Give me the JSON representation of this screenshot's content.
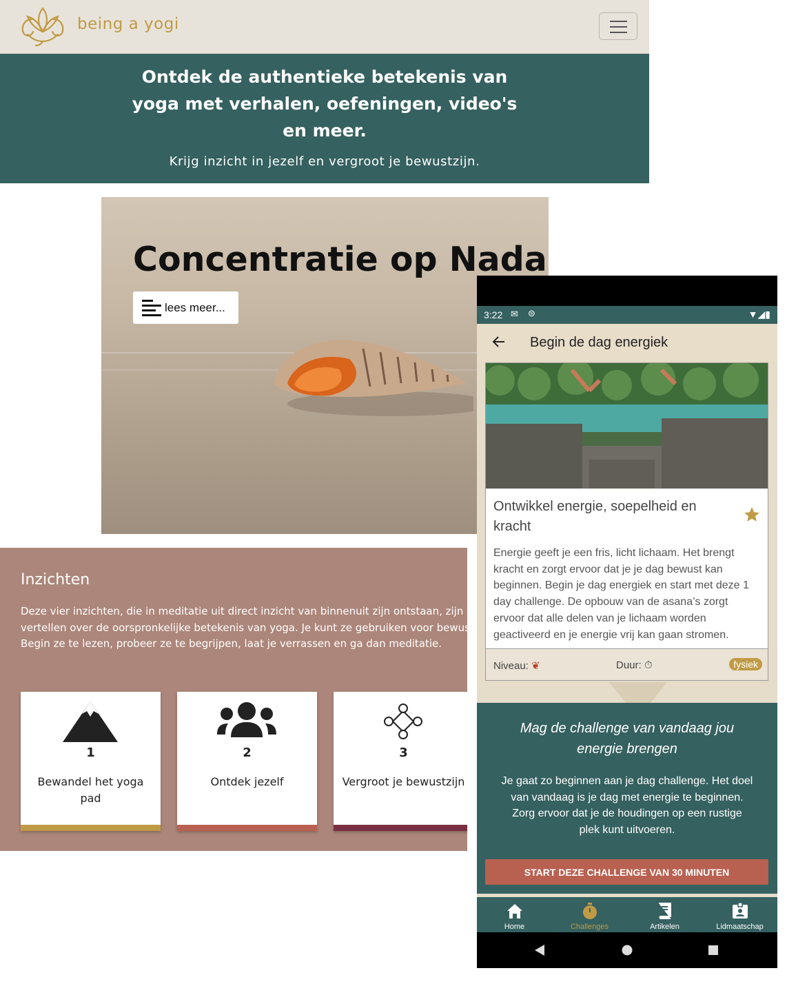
{
  "site": {
    "logo_text": "being a yogi",
    "hero_title": "Ontdek de authentieke betekenis van yoga met verhalen, oefeningen, video's en meer.",
    "hero_subtitle": "Krijg inzicht in jezelf en vergroot je bewustzijn.",
    "feature": {
      "title": "Concentratie op Nada",
      "read_more_label": "lees meer..."
    },
    "insights": {
      "heading": "Inzichten",
      "text": "Deze vier inzichten, die in meditatie uit direct inzicht van binnenuit zijn ontstaan, zijn het vertellen over de oorspronkelijke betekenis van yoga. Je kunt ze gebruiken voor bewustzijn. Begin ze te lezen, probeer ze te begrijpen, laat je verrassen en ga dan meditatie.",
      "cards": [
        {
          "number": "1",
          "label": "Bewandel het yoga pad",
          "icon": "mountain-icon",
          "color": "#c09a45"
        },
        {
          "number": "2",
          "label": "Ontdek jezelf",
          "icon": "users-icon",
          "color": "#b96151"
        },
        {
          "number": "3",
          "label": "Vergroot je bewustzijn",
          "icon": "network-icon",
          "color": "#7a3040"
        }
      ]
    }
  },
  "app": {
    "status_time": "3:22",
    "title": "Begin de dag energiek",
    "challenge": {
      "title": "Ontwikkel energie, soepelheid en kracht",
      "body": "Energie geeft je een fris, licht lichaam. Het brengt kracht en zorgt ervoor dat je je dag bewust kan beginnen. Begin je dag energiek en start met deze 1 day challenge. De opbouw van de asana’s zorgt ervoor dat alle delen van je lichaam worden geactiveerd en je energie vrij kan gaan stromen.",
      "level_label": "Niveau:",
      "duration_label": "Duur:",
      "tag": "fysiek"
    },
    "message_heading": "Mag de challenge van vandaag jou energie brengen",
    "message_text": "Je gaat zo beginnen aan je dag challenge. Het doel van vandaag is je dag met energie te beginnen. Zorg ervoor dat je de houdingen op een rustige plek kunt uitvoeren.",
    "start_button": "START DEZE CHALLENGE VAN 30 MINUTEN",
    "nav": [
      {
        "label": "Home",
        "icon": "home-icon",
        "active": false
      },
      {
        "label": "Challenges",
        "icon": "stopwatch-icon",
        "active": true
      },
      {
        "label": "Artikelen",
        "icon": "book-icon",
        "active": false
      },
      {
        "label": "Lidmaatschap",
        "icon": "id-badge-icon",
        "active": false
      }
    ]
  },
  "colors": {
    "teal": "#356160",
    "gold": "#c09a45",
    "rose": "#ac867a",
    "terracotta": "#b96151",
    "cream": "#e6dcca"
  }
}
